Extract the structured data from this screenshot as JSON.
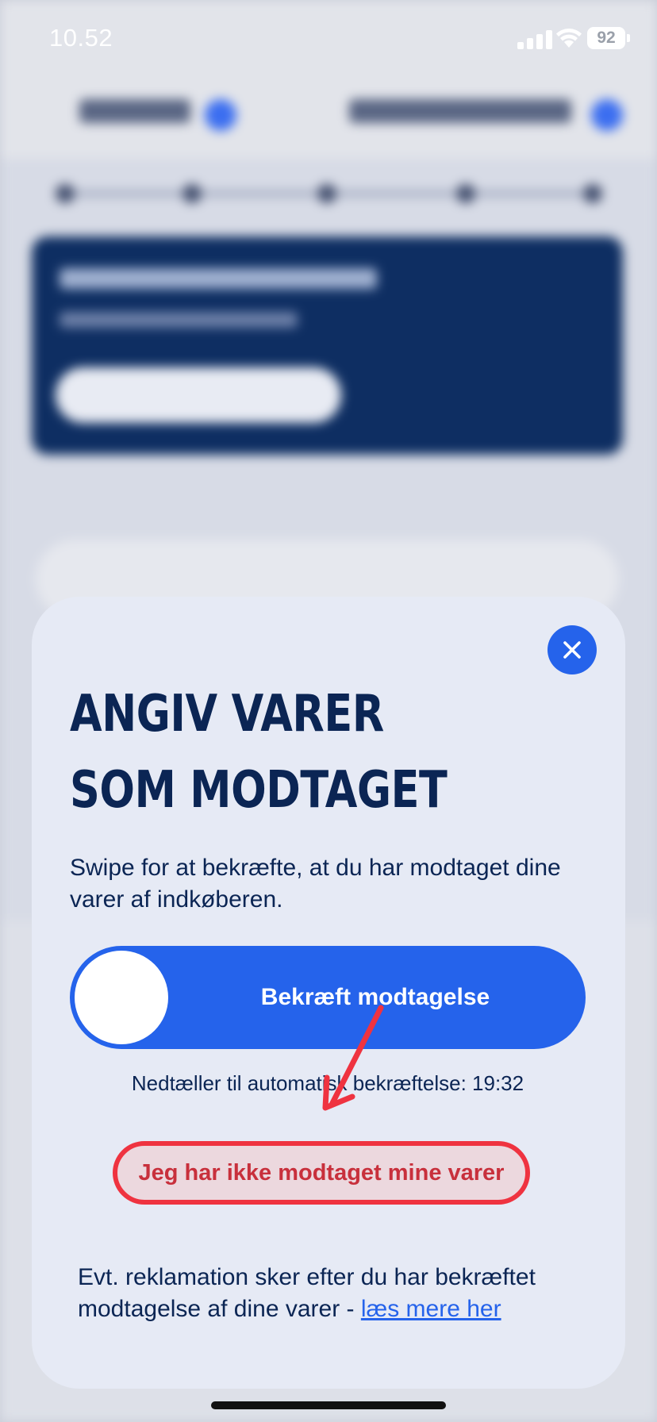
{
  "status_bar": {
    "time": "10.52",
    "battery": "92"
  },
  "modal": {
    "title_line1": "ANGIV VARER",
    "title_line2": "SOM MODTAGET",
    "description": "Swipe for at bekræfte, at du har modtaget dine varer af indkøberen.",
    "swipe_label": "Bekræft modtagelse",
    "countdown": "Nedtæller til automatisk bekræftelse: 19:32",
    "not_received_label": "Jeg har ikke modtaget mine varer",
    "footer_text": "Evt. reklamation sker efter du har bekræftet modtagelse af dine varer - ",
    "footer_link": "læs mere her"
  },
  "colors": {
    "primary": "#2563eb",
    "title": "#0b2554",
    "modal_bg": "#e6eaf5",
    "annotation": "#ef3340"
  },
  "icons": {
    "close": "close-icon",
    "signal": "cellular-signal-icon",
    "wifi": "wifi-icon",
    "battery": "battery-icon"
  }
}
